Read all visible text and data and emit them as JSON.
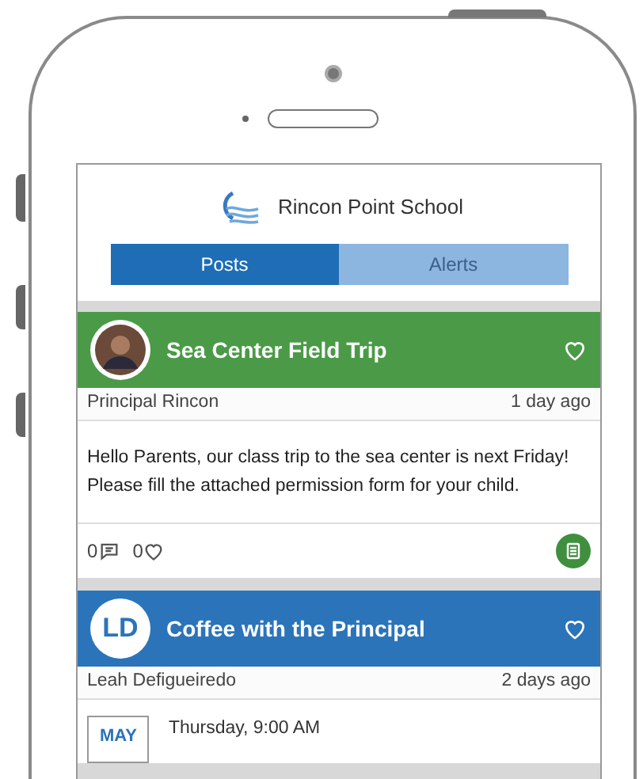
{
  "school": {
    "name": "Rincon Point School"
  },
  "tabs": [
    {
      "label": "Posts",
      "selected": true
    },
    {
      "label": "Alerts",
      "selected": false
    }
  ],
  "posts": [
    {
      "kind": "post",
      "color": "#4b9a47",
      "avatar": {
        "kind": "photo"
      },
      "title": "Sea Center Field Trip",
      "liked": false,
      "author": "Principal Rincon",
      "time": "1 day ago",
      "body": "Hello Parents, our class trip to the sea center is next Friday! Please fill the attached permission form for your child.",
      "comments": "0",
      "likes": "0",
      "attachment": true
    },
    {
      "kind": "event",
      "color": "#2b74b9",
      "avatar": {
        "kind": "initials",
        "text": "LD"
      },
      "title": "Coffee with the Principal",
      "liked": false,
      "author": "Leah Defigueiredo",
      "time": "2 days ago",
      "month": "MAY",
      "when": "Thursday, 9:00 AM"
    }
  ]
}
